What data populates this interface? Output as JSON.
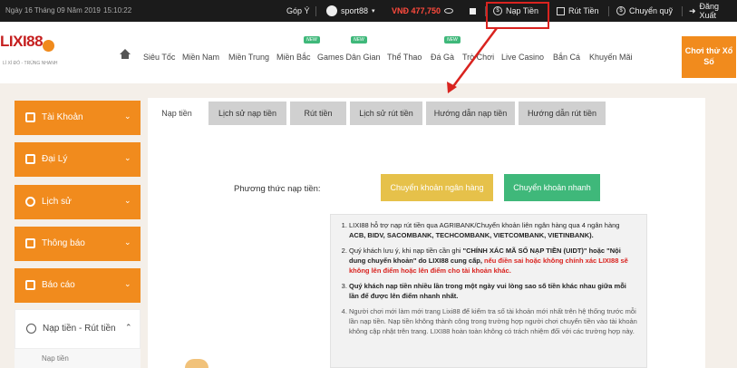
{
  "topbar": {
    "date": "Ngày 16 Tháng 09 Năm 2019",
    "time": "15:10:22",
    "feedback": "Góp Ý",
    "username": "sport88",
    "balance": "VNĐ 477,750",
    "deposit": "Nạp Tiền",
    "withdraw": "Rút Tiền",
    "transfer": "Chuyển quỹ",
    "logout": "Đăng Xuất"
  },
  "header": {
    "logo": "LIXI88",
    "logo_sub": "LÌ XÌ ĐỎ - TRÚNG NHANH",
    "nav": [
      "Siêu Tốc",
      "Miền Nam",
      "Miền Trung",
      "Miền Bắc",
      "Games Dân Gian",
      "Thể Thao",
      "Đá Gà",
      "Trò Chơi",
      "Live Casino",
      "Bắn Cá",
      "Khuyến Mãi"
    ],
    "new_badge": "NEW",
    "try_button": "Chơi thử Xổ Số"
  },
  "sidebar": {
    "items": [
      "Tài Khoản",
      "Đại Lý",
      "Lịch sử",
      "Thông báo",
      "Báo cáo"
    ],
    "sub_item": "Nạp tiền - Rút tiền",
    "sub_child": "Nạp tiền"
  },
  "tabs": [
    "Nạp tiền",
    "Lịch sử nạp tiền",
    "Rút tiền",
    "Lịch sử rút tiền",
    "Hướng dẫn nạp tiền",
    "Hướng dẫn rút tiền"
  ],
  "deposit_form": {
    "method_label": "Phương thức nạp tiền:",
    "btn_bank": "Chuyển khoản ngân hàng",
    "btn_fast": "Chuyển khoản nhanh"
  },
  "notes": [
    {
      "pre": "LIXI88 hỗ trợ nạp rút tiền qua AGRIBANK/Chuyển khoản liên ngân hàng qua 4 ngân hàng ",
      "bold": "ACB, BIDV, SACOMBANK, TECHCOMBANK, VIETCOMBANK, VIETINBANK).",
      "red": "",
      "post": ""
    },
    {
      "pre": "Quý khách lưu ý, khi nạp tiền cần ghi ",
      "bold": "\"CHÍNH XÁC MÃ SỐ NẠP TIỀN (UIDT)\" hoặc \"Nội dung chuyển khoản\" do LIXI88 cung cấp,",
      "red": " nếu điền sai hoặc không chính xác LIXI88 sẽ không lên điểm hoặc lên điểm cho tài khoản khác.",
      "post": ""
    },
    {
      "pre": "",
      "bold": "Quý khách nạp tiền nhiều lần trong một ngày vui lòng sao số tiền khác nhau giữa mỗi lần để được lên điểm nhanh nhất.",
      "red": "",
      "post": ""
    },
    {
      "pre": "Người chơi mới làm mới trang Lixi88 để kiểm tra số tài khoản mới nhất trên hệ thống trước mỗi lần nạp tiền. Nạp tiền không thành công trong trường hợp người chơi chuyển tiền vào tài khoản không cập nhật trên trang. LIXI88 hoàn toàn không có trách nhiệm đối với các trường hợp này.",
      "bold": "",
      "red": "",
      "post": ""
    }
  ],
  "colors": {
    "orange": "#f18b1d",
    "highlight_red": "#d9231f",
    "btn_yellow": "#e6c14a",
    "btn_green": "#3fb87a"
  }
}
